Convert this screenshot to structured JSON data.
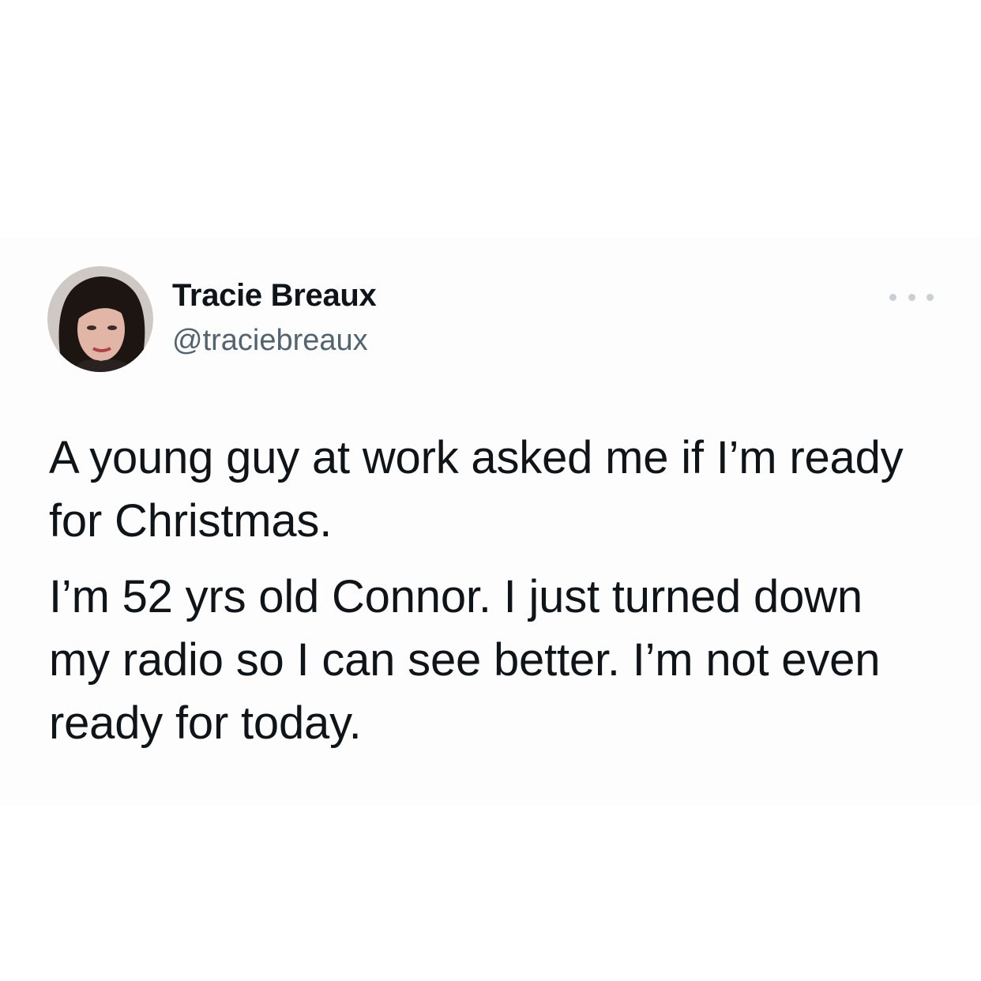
{
  "author": {
    "display_name": "Tracie Breaux",
    "handle": "@traciebreaux",
    "avatar": "profile-photo"
  },
  "menu": {
    "icon": "more-horizontal-icon"
  },
  "tweet": {
    "paragraphs": [
      "A young guy at work asked me if I’m ready for Christmas.",
      "I’m 52 yrs old Connor. I just turned down my radio so I can see better. I’m not even ready for today."
    ]
  },
  "colors": {
    "text": "#0f1419",
    "secondary_text": "#536471",
    "background": "#ffffff"
  }
}
